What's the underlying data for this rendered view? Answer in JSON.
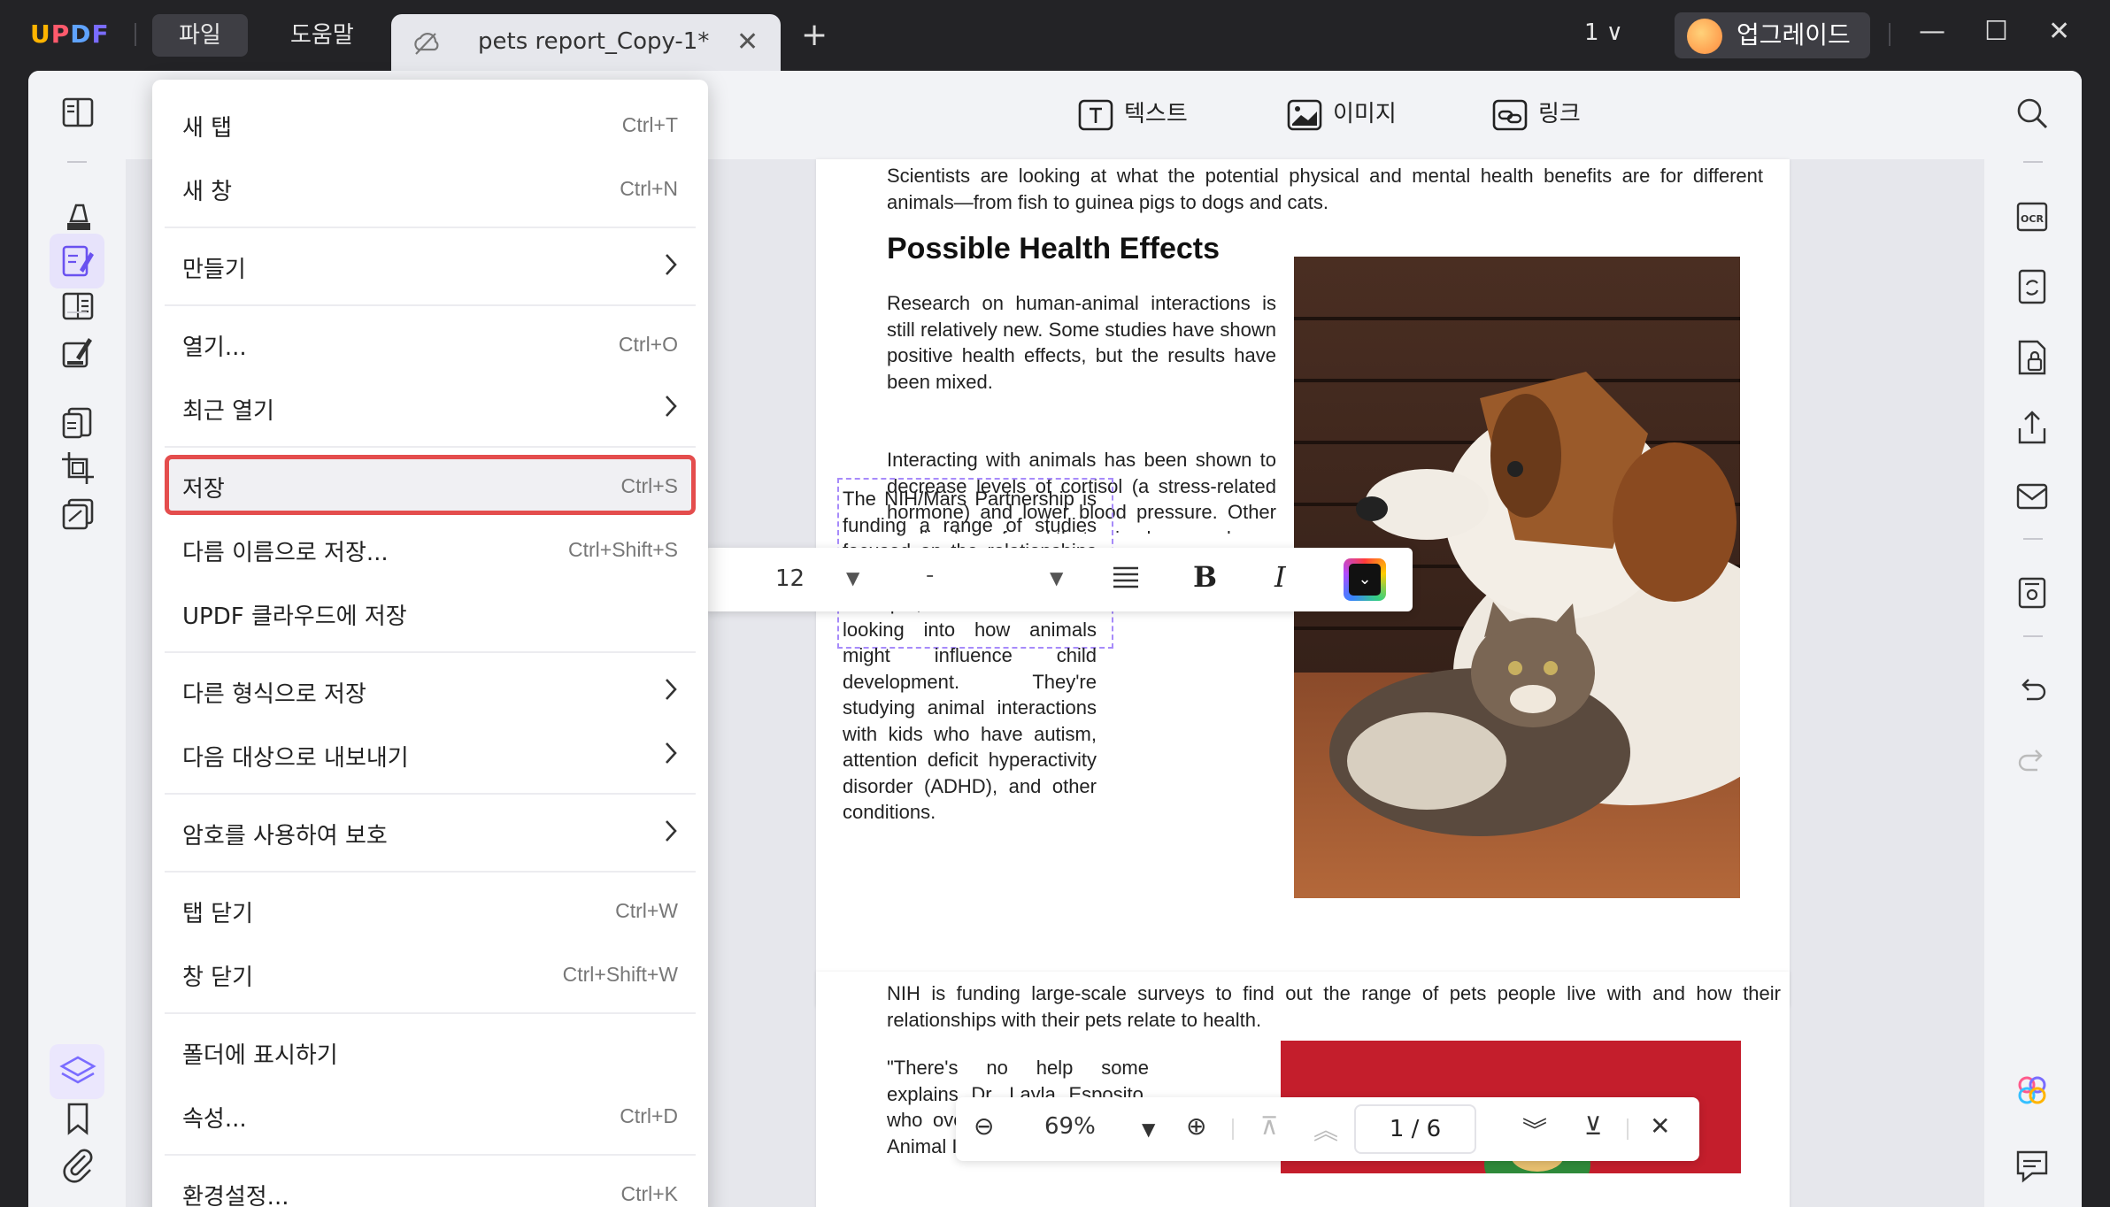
{
  "app": {
    "logo": "UPDF"
  },
  "titlebar": {
    "menus": [
      "파일",
      "도움말"
    ],
    "tab_title": "pets report_Copy-1*",
    "tab_close": "✕",
    "new_tab": "+",
    "page_count": "1 ∨",
    "upgrade_label": "업그레이드"
  },
  "toolbar": {
    "tools": [
      "텍스트",
      "이미지",
      "링크"
    ]
  },
  "file_menu": {
    "items": [
      {
        "label": "새 탭",
        "shortcut": "Ctrl+T"
      },
      {
        "label": "새 창",
        "shortcut": "Ctrl+N"
      },
      {
        "label": "만들기",
        "submenu": true
      },
      {
        "label": "열기...",
        "shortcut": "Ctrl+O"
      },
      {
        "label": "최근 열기",
        "submenu": true
      },
      {
        "label": "저장",
        "shortcut": "Ctrl+S",
        "highlighted": true
      },
      {
        "label": "다름 이름으로 저장...",
        "shortcut": "Ctrl+Shift+S"
      },
      {
        "label": "UPDF 클라우드에 저장"
      },
      {
        "label": "다른 형식으로 저장",
        "submenu": true
      },
      {
        "label": "다음 대상으로 내보내기",
        "submenu": true
      },
      {
        "label": "암호를 사용하여 보호",
        "submenu": true
      },
      {
        "label": "탭 닫기",
        "shortcut": "Ctrl+W"
      },
      {
        "label": "창 닫기",
        "shortcut": "Ctrl+Shift+W"
      },
      {
        "label": "폴더에 표시하기"
      },
      {
        "label": "속성...",
        "shortcut": "Ctrl+D"
      },
      {
        "label": "환경설정...",
        "shortcut": "Ctrl+K"
      }
    ]
  },
  "document": {
    "intro": "Scientists are looking at what the potential physical and mental health benefits are for different animals—from fish to guinea pigs to dogs and cats.",
    "heading": "Possible Health Effects",
    "para1": "Research on human-animal interactions is still relatively new. Some studies have shown positive health effects, but the results have been mixed.",
    "para2": "Interacting with animals has been shown to decrease levels of cortisol (a stress-related hormone) and lower blood pressure. Other studies have found that animals can reduce",
    "para3": "The NIH/Mars Partnership is funding a range of studies focused on the relationships we have with animals. For example, researchers are looking into how animals might influence child development. They're studying animal interactions with kids who have autism, attention deficit hyperactivity disorder (ADHD), and other conditions.",
    "page2_para1": "NIH is funding large-scale surveys to find out the range of pets people live with and how their relationships with their pets relate to health.",
    "page2_para2": "\"There's no help some explains Dr. Layla Esposito, who oversees NIH's Human-Animal Interaction Research"
  },
  "format_toolbar": {
    "font_size": "12",
    "font_name": "-"
  },
  "zoom": {
    "level": "69%",
    "page_indicator": "1 / 6"
  },
  "colors": {
    "accent": "#7a6cff",
    "highlight_border": "#e44d4d"
  }
}
